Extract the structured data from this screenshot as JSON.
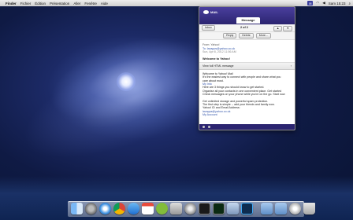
{
  "menubar": {
    "app_menus": [
      "Finder",
      "Fichier",
      "Édition",
      "Présentation",
      "Aller",
      "Fenêtre",
      "Aide"
    ],
    "clock": "Sam 15:23"
  },
  "mail_popup": {
    "brand": "MAIL",
    "tab_label": "Message",
    "inbox_button": "Inbox",
    "pager": "2 of 2",
    "actions": [
      "Reply",
      "Delete",
      "More..."
    ],
    "from_label": "From: Yahoo!",
    "to_label": "To: lavapps@yahoo.co.uk",
    "date": "Sun, Apr 8, 2012 11:56 AM",
    "subject": "Welcome to Yahoo!",
    "full_message_link": "View full HTML message",
    "body_lines": [
      "Welcome to Yahoo! Mail",
      "It's the easiest way to connect with people and share what you",
      "care about most.",
      "My Info",
      "Here are 3 things you should know to get started.",
      "Organise all your contacts in one convenient place. Get started",
      "Check messages on your phone while you're on the go. Start now",
      "",
      "Get unlimited storage and powerful spam protection.",
      "The first step is simple -- add your friends and family now.",
      "Yahoo! ID and Email Address:",
      "lavapps@yahoo.co.uk",
      "My Account"
    ]
  },
  "dock": {
    "items": [
      "finder-icon",
      "launchpad-icon",
      "safari-icon",
      "chrome-icon",
      "app-store-icon",
      "calendar-icon",
      "spotify-icon",
      "preview-icon",
      "system-preferences-icon",
      "terminal-icon",
      "activity-monitor-icon",
      "image-icon",
      "photoshop-icon",
      "folder-icon",
      "downloads-icon",
      "settings-icon",
      "trash-icon"
    ]
  }
}
